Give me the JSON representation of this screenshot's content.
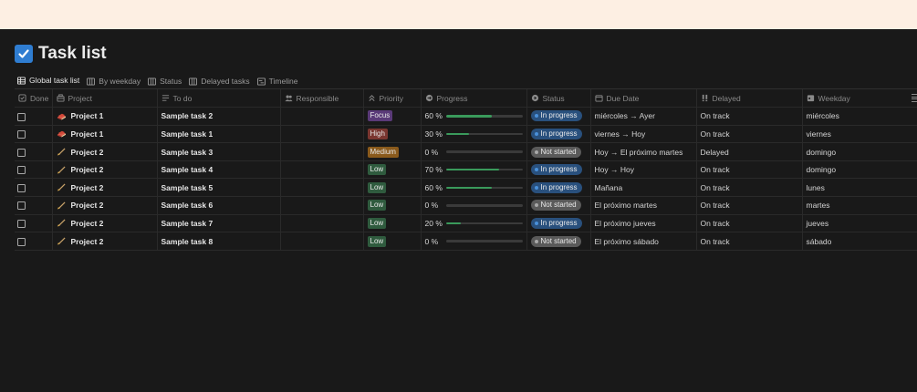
{
  "page": {
    "title": "Task list"
  },
  "tabs": [
    {
      "label": "Global task list",
      "icon": "table-icon",
      "active": true
    },
    {
      "label": "By weekday",
      "icon": "board-icon",
      "active": false
    },
    {
      "label": "Status",
      "icon": "board-icon",
      "active": false
    },
    {
      "label": "Delayed tasks",
      "icon": "board-icon",
      "active": false
    },
    {
      "label": "Timeline",
      "icon": "timeline-icon",
      "active": false
    }
  ],
  "columns": {
    "done": "Done",
    "project": "Project",
    "todo": "To do",
    "responsible": "Responsible",
    "priority": "Priority",
    "progress": "Progress",
    "status": "Status",
    "due": "Due Date",
    "delayed": "Delayed",
    "weekday": "Weekday"
  },
  "colors": {
    "priority": {
      "Focus": "#5a3a78",
      "High": "#7a3630",
      "Medium": "#8a5a1c",
      "Low": "#2f5b3e"
    },
    "status": {
      "In progress": "#29507d",
      "Not started": "#5a5a5a"
    },
    "status_dot": {
      "In progress": "#4a90d9",
      "Not started": "#a8a8a8"
    }
  },
  "rows": [
    {
      "done": false,
      "project": "Project 1",
      "project_icon": "book-icon",
      "todo": "Sample task 2",
      "responsible": "",
      "priority": "Focus",
      "progress_label": "60 %",
      "progress": 0.6,
      "status": "In progress",
      "due": "miércoles → Ayer",
      "delayed": "On track",
      "weekday": "miércoles"
    },
    {
      "done": false,
      "project": "Project 1",
      "project_icon": "book-icon",
      "todo": "Sample task 1",
      "responsible": "",
      "priority": "High",
      "progress_label": "30 %",
      "progress": 0.3,
      "status": "In progress",
      "due": "viernes → Hoy",
      "delayed": "On track",
      "weekday": "viernes"
    },
    {
      "done": false,
      "project": "Project 2",
      "project_icon": "brush-icon",
      "todo": "Sample task 3",
      "responsible": "",
      "priority": "Medium",
      "progress_label": "0 %",
      "progress": 0,
      "status": "Not started",
      "due": "Hoy → El próximo martes",
      "delayed": "Delayed",
      "weekday": "domingo"
    },
    {
      "done": false,
      "project": "Project 2",
      "project_icon": "brush-icon",
      "todo": "Sample task 4",
      "responsible": "",
      "priority": "Low",
      "progress_label": "70 %",
      "progress": 0.7,
      "status": "In progress",
      "due": "Hoy → Hoy",
      "delayed": "On track",
      "weekday": "domingo"
    },
    {
      "done": false,
      "project": "Project 2",
      "project_icon": "brush-icon",
      "todo": "Sample task 5",
      "responsible": "",
      "priority": "Low",
      "progress_label": "60 %",
      "progress": 0.6,
      "status": "In progress",
      "due": "Mañana",
      "delayed": "On track",
      "weekday": "lunes"
    },
    {
      "done": false,
      "project": "Project 2",
      "project_icon": "brush-icon",
      "todo": "Sample task 6",
      "responsible": "",
      "priority": "Low",
      "progress_label": "0 %",
      "progress": 0,
      "status": "Not started",
      "due": "El próximo martes",
      "delayed": "On track",
      "weekday": "martes"
    },
    {
      "done": false,
      "project": "Project 2",
      "project_icon": "brush-icon",
      "todo": "Sample task 7",
      "responsible": "",
      "priority": "Low",
      "progress_label": "20 %",
      "progress": 0.2,
      "status": "In progress",
      "due": "El próximo jueves",
      "delayed": "On track",
      "weekday": "jueves"
    },
    {
      "done": false,
      "project": "Project 2",
      "project_icon": "brush-icon",
      "todo": "Sample task 8",
      "responsible": "",
      "priority": "Low",
      "progress_label": "0 %",
      "progress": 0,
      "status": "Not started",
      "due": "El próximo sábado",
      "delayed": "On track",
      "weekday": "sábado"
    }
  ]
}
